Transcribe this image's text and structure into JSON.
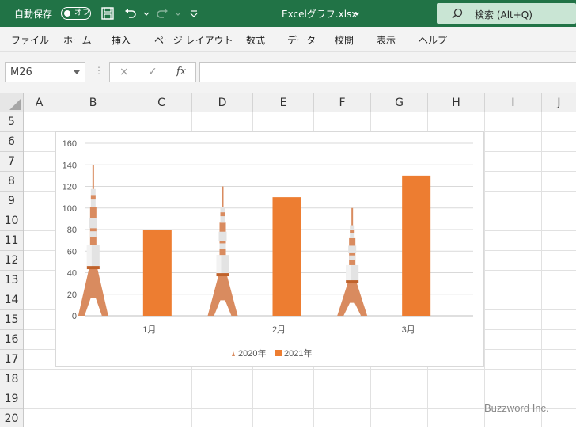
{
  "titlebar": {
    "autosave_label": "自動保存",
    "toggle_text": "オフ",
    "filename": "Excelグラフ.xlsx",
    "search_text": "検索 (Alt+Q)",
    "bg_color": "#217346"
  },
  "ribbon": {
    "tabs": [
      "ファイル",
      "ホーム",
      "挿入",
      "ページ レイアウト",
      "数式",
      "データ",
      "校閲",
      "表示",
      "ヘルプ"
    ]
  },
  "formula_bar": {
    "name_box": "M26",
    "cancel_icon": "×",
    "enter_icon": "✓",
    "fx_label": "fx",
    "formula": ""
  },
  "grid": {
    "columns": [
      "A",
      "B",
      "C",
      "D",
      "E",
      "F",
      "G",
      "H",
      "I",
      "J"
    ],
    "rows": [
      "5",
      "6",
      "7",
      "8",
      "9",
      "10",
      "11",
      "12",
      "13",
      "14",
      "15",
      "16",
      "17",
      "18",
      "19",
      "20"
    ]
  },
  "chart_data": {
    "type": "bar",
    "categories": [
      "1月",
      "2月",
      "3月"
    ],
    "series": [
      {
        "name": "2020年",
        "values": [
          140,
          120,
          100
        ],
        "color": "#d98b5f",
        "style": "tower-pictograph"
      },
      {
        "name": "2021年",
        "values": [
          80,
          110,
          130
        ],
        "color": "#ed7d31"
      }
    ],
    "ylim": [
      0,
      160
    ],
    "yticks": [
      "0",
      "20",
      "40",
      "60",
      "80",
      "100",
      "120",
      "140",
      "160"
    ],
    "grid": true,
    "legend": "bottom"
  },
  "watermark": "Buzzword Inc."
}
